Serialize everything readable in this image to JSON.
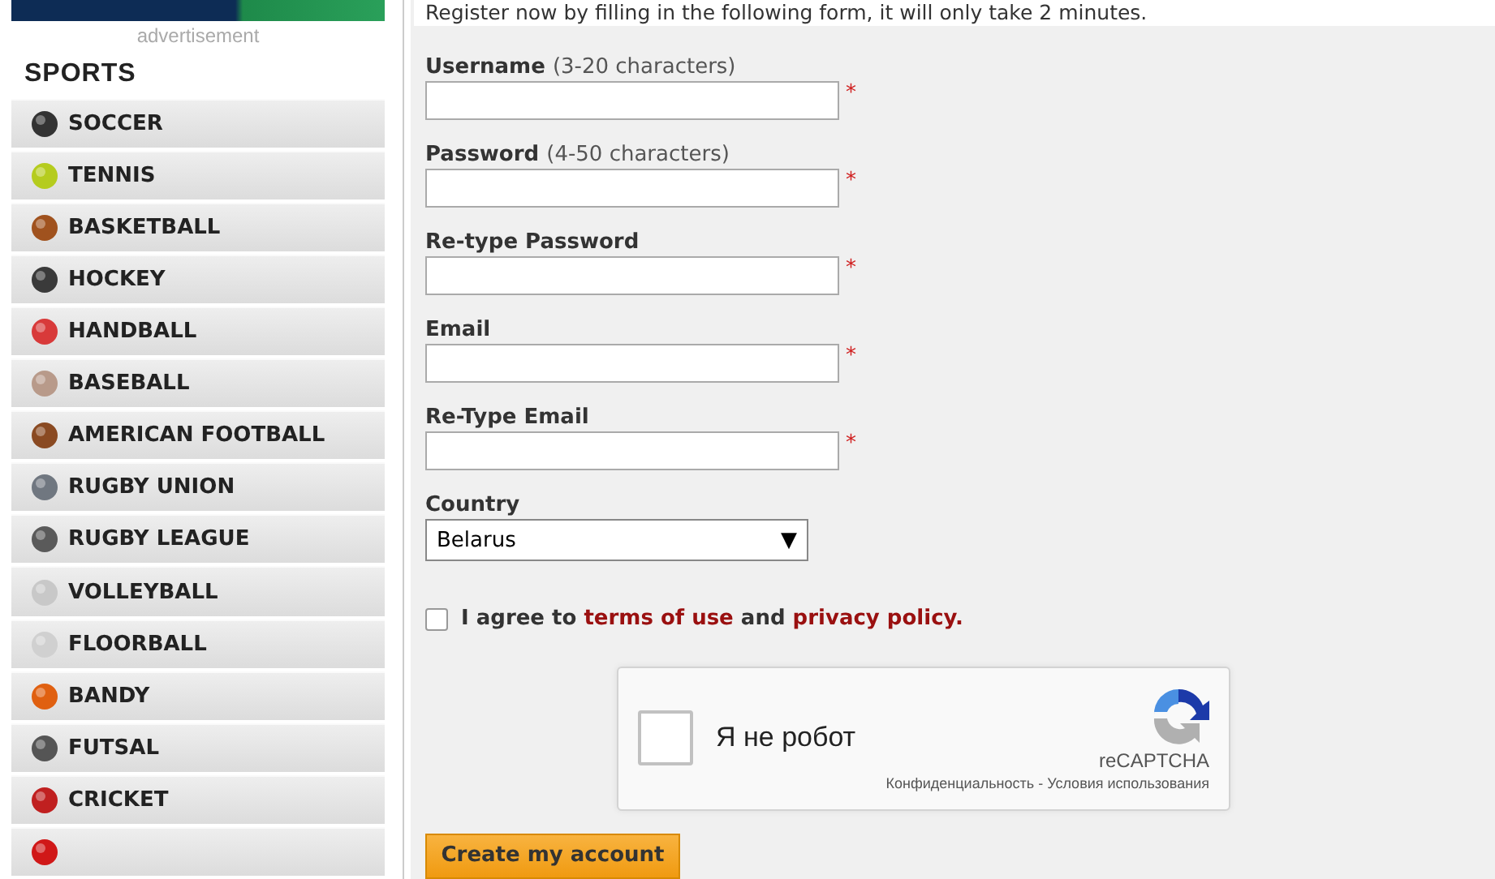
{
  "advertisement": {
    "caption": "advertisement"
  },
  "sidebar": {
    "title": "SPORTS",
    "items": [
      {
        "label": "SOCCER",
        "color": "#333333"
      },
      {
        "label": "TENNIS",
        "color": "#b5cc1e"
      },
      {
        "label": "BASKETBALL",
        "color": "#a0521e"
      },
      {
        "label": "HOCKEY",
        "color": "#3a3a3a"
      },
      {
        "label": "HANDBALL",
        "color": "#d83a3a"
      },
      {
        "label": "BASEBALL",
        "color": "#b89a8a"
      },
      {
        "label": "AMERICAN FOOTBALL",
        "color": "#8a4a22"
      },
      {
        "label": "RUGBY UNION",
        "color": "#707780"
      },
      {
        "label": "RUGBY LEAGUE",
        "color": "#5a5a5a"
      },
      {
        "label": "VOLLEYBALL",
        "color": "#c8c8c8"
      },
      {
        "label": "FLOORBALL",
        "color": "#d0d0d0"
      },
      {
        "label": "BANDY",
        "color": "#e06010"
      },
      {
        "label": "FUTSAL",
        "color": "#555555"
      },
      {
        "label": "CRICKET",
        "color": "#c02020"
      },
      {
        "color": "#d01818"
      }
    ]
  },
  "form": {
    "intro": "Register now by filling in the following form, it will only take 2 minutes.",
    "fields": [
      {
        "kind": "text",
        "label": "Username",
        "hint": "(3-20 characters)",
        "required": true
      },
      {
        "kind": "text",
        "label": "Password",
        "hint": "(4-50 characters)",
        "required": true
      },
      {
        "kind": "text",
        "label": "Re-type Password",
        "required": true
      },
      {
        "kind": "text",
        "label": "Email",
        "required": true
      },
      {
        "kind": "text",
        "label": "Re-Type Email",
        "required": true
      },
      {
        "kind": "select",
        "label": "Country",
        "value": "Belarus",
        "arrow": "▼",
        "required": false
      }
    ],
    "required_mark": "*",
    "agree": {
      "checked": false,
      "before": "I agree to",
      "link1": "terms of use",
      "middle": "and",
      "link2": "privacy policy."
    },
    "captcha": {
      "checked": false,
      "label": "Я не робот",
      "brand": "reCAPTCHA",
      "privacy": "Конфиденциальность",
      "separator": "-",
      "terms": "Условия использования"
    },
    "submit": "Create my account"
  }
}
